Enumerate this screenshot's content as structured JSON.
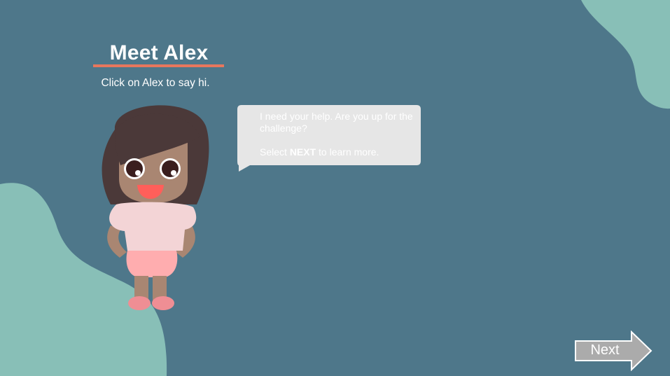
{
  "scene": {
    "title": "Meet Alex",
    "subtitle": "Click on Alex to say hi."
  },
  "speech_bubble": {
    "line1": "I need your help. Are you up for the challenge?",
    "line2_prefix": "Select ",
    "line2_bold": "NEXT",
    "line2_suffix": " to learn more."
  },
  "navigation": {
    "next_label": "Next"
  },
  "colors": {
    "background": "#4e778a",
    "blob": "#88bfb7",
    "accent_underline": "#e8775d",
    "bubble": "#e6e6e6",
    "button": "#ababab"
  }
}
